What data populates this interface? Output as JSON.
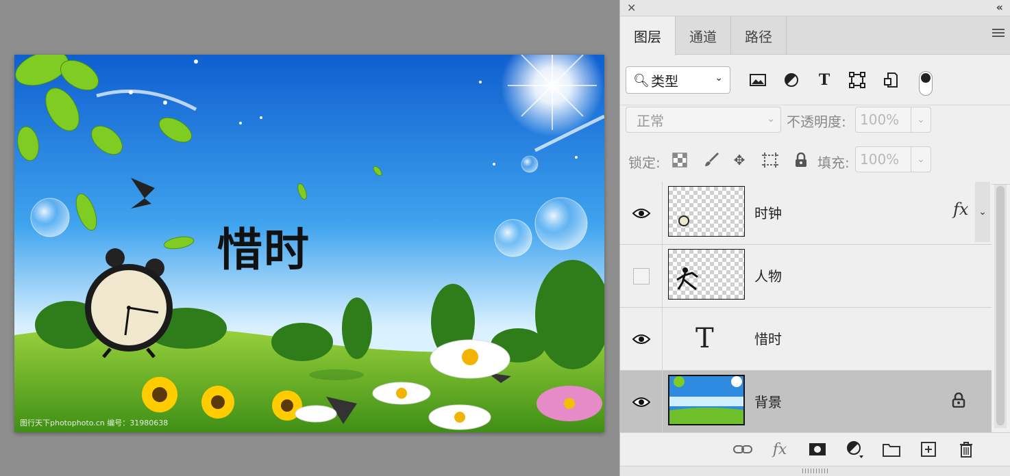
{
  "canvas": {
    "title_text": "惜时",
    "watermark": "图行天下photophoto.cn 编号：31980638"
  },
  "panel": {
    "tabs": [
      {
        "label": "图层",
        "active": true
      },
      {
        "label": "通道",
        "active": false
      },
      {
        "label": "路径",
        "active": false
      }
    ],
    "filter": {
      "kind_label": "类型",
      "icons": [
        "image-filter-icon",
        "adjustment-filter-icon",
        "type-filter-icon",
        "shape-filter-icon",
        "smart-object-filter-icon"
      ]
    },
    "blend_mode": "正常",
    "opacity_label": "不透明度:",
    "opacity_value": "100%",
    "lock_label": "锁定:",
    "fill_label": "填充:",
    "fill_value": "100%",
    "layers": [
      {
        "name": "时钟",
        "visible": true,
        "kind": "pixel",
        "fx": "fx",
        "selected": false
      },
      {
        "name": "人物",
        "visible": false,
        "kind": "pixel",
        "selected": false
      },
      {
        "name": "惜时",
        "visible": true,
        "kind": "text",
        "selected": false
      },
      {
        "name": "背景",
        "visible": true,
        "kind": "background",
        "locked": true,
        "selected": true
      }
    ],
    "bottom_icons": [
      "link-layers-icon",
      "layer-style-icon",
      "layer-mask-icon",
      "adjustment-layer-icon",
      "new-group-icon",
      "new-layer-icon",
      "delete-layer-icon"
    ]
  },
  "colors": {
    "sky_top": "#1a6fd8",
    "sky_bottom": "#e4f4ff",
    "grass": "#6fbf2a",
    "selected_row": "#c2c2c2"
  }
}
